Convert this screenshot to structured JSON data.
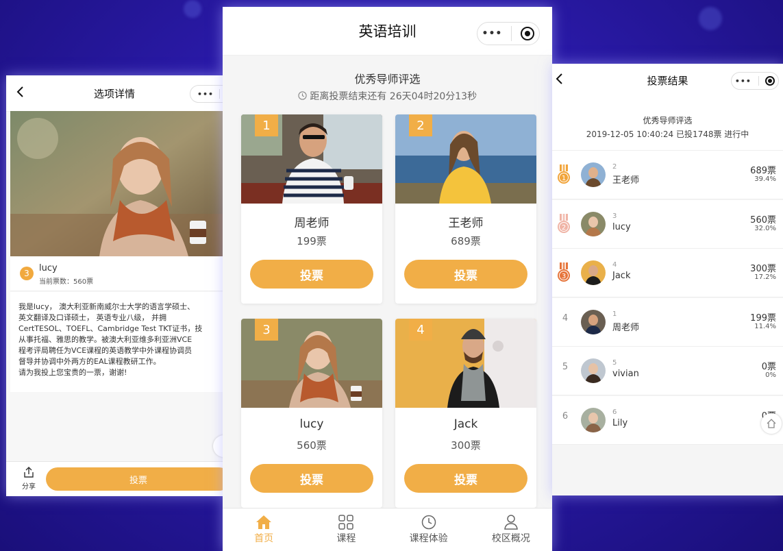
{
  "colors": {
    "accent": "#f1ae47",
    "background": "#2a1aa8"
  },
  "left": {
    "title": "选项详情",
    "candidate": {
      "number": "3",
      "name": "lucy",
      "votes_line": "当前票数：560票"
    },
    "description": "我是lucy， 澳大利亚新南威尔士大学的语言学硕士、\n英文翻译及口译硕士， 英语专业八级， 并拥\nCertTESOL、TOEFL、Cambridge Test TKT证书，技\n从事托福、雅思的教学。被澳大利亚维多利亚洲VCE\n程考评局聘任为VCE课程的英语教学中外课程协调员\n督导并协调中外两方的EAL课程教研工作。\n请为我投上您宝贵的一票，谢谢!",
    "share_label": "分享",
    "vote_label": "投票"
  },
  "middle": {
    "title": "英语培训",
    "section_title": "优秀导师评选",
    "countdown": "距离投票结束还有 26天04时20分13秒",
    "vote_label": "投票",
    "cards": [
      {
        "rank": "1",
        "name": "周老师",
        "votes": "199票"
      },
      {
        "rank": "2",
        "name": "王老师",
        "votes": "689票"
      },
      {
        "rank": "3",
        "name": "lucy",
        "votes": "560票"
      },
      {
        "rank": "4",
        "name": "Jack",
        "votes": "300票"
      }
    ],
    "tabs": [
      {
        "label": "首页",
        "icon": "home-icon"
      },
      {
        "label": "课程",
        "icon": "grid-icon"
      },
      {
        "label": "课程体验",
        "icon": "clock-icon"
      },
      {
        "label": "校区概况",
        "icon": "person-icon"
      }
    ]
  },
  "right": {
    "title": "投票结果",
    "section_title": "优秀导师评选",
    "meta": "2019-12-05 10:40:24   已投1748票   进行中",
    "results": [
      {
        "pos": "1",
        "id": "2",
        "name": "王老师",
        "votes": "689票",
        "pct": "39.4%"
      },
      {
        "pos": "2",
        "id": "3",
        "name": "lucy",
        "votes": "560票",
        "pct": "32.0%"
      },
      {
        "pos": "3",
        "id": "4",
        "name": "Jack",
        "votes": "300票",
        "pct": "17.2%"
      },
      {
        "pos": "4",
        "id": "1",
        "name": "周老师",
        "votes": "199票",
        "pct": "11.4%"
      },
      {
        "pos": "5",
        "id": "5",
        "name": "vivian",
        "votes": "0票",
        "pct": "0%"
      },
      {
        "pos": "6",
        "id": "6",
        "name": "Lily",
        "votes": "0票",
        "pct": "0%"
      }
    ]
  }
}
